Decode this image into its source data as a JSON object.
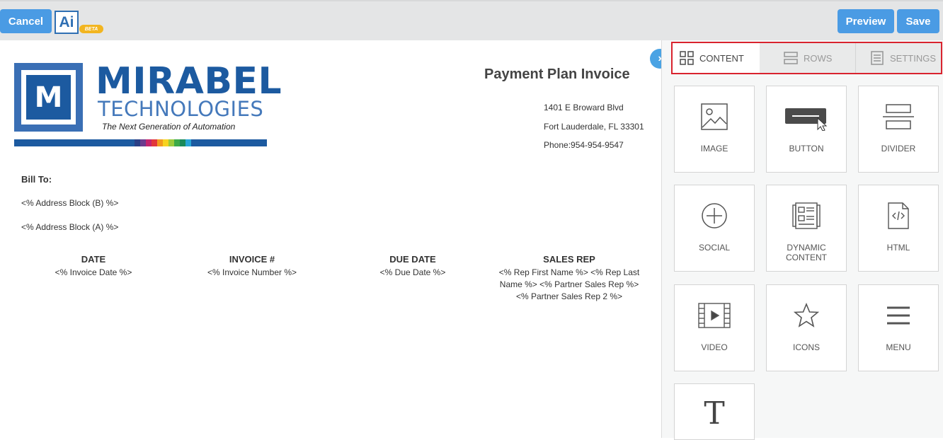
{
  "toolbar": {
    "cancel_label": "Cancel",
    "ai_label": "Ai",
    "beta_label": "BETA",
    "preview_label": "Preview",
    "save_label": "Save"
  },
  "colors": {
    "accent": "#4a9be4",
    "brand": "#1c5aa0",
    "highlight": "#d9232e"
  },
  "logo": {
    "letter": "M",
    "title": "MIRABEL",
    "subtitle": "TECHNOLOGIES",
    "tagline": "The Next Generation of Automation"
  },
  "invoice": {
    "title": "Payment Plan Invoice",
    "address_line1": "1401 E Broward Blvd",
    "address_line2": "Fort Lauderdale, FL 33301",
    "phone": "Phone:954-954-9547",
    "bill_to": "Bill To:",
    "address_block_b": "<% Address Block (B) %>",
    "address_block_a": "<% Address Block (A) %>",
    "columns": [
      {
        "header": "DATE",
        "value": "<% Invoice Date %>"
      },
      {
        "header": "INVOICE #",
        "value": "<% Invoice Number %>"
      },
      {
        "header": "DUE DATE",
        "value": "<% Due Date %>"
      },
      {
        "header": "SALES REP",
        "value": "<% Rep First Name %>  <% Rep Last Name %> <% Partner Sales Rep %> <% Partner Sales Rep 2 %>"
      }
    ]
  },
  "panel": {
    "tabs": [
      {
        "label": "CONTENT",
        "icon": "grid-icon",
        "active": true
      },
      {
        "label": "ROWS",
        "icon": "rows-icon",
        "active": false
      },
      {
        "label": "SETTINGS",
        "icon": "settings-icon",
        "active": false
      }
    ],
    "blocks": [
      {
        "label": "IMAGE",
        "icon": "image-icon"
      },
      {
        "label": "BUTTON",
        "icon": "button-icon"
      },
      {
        "label": "DIVIDER",
        "icon": "divider-icon"
      },
      {
        "label": "SOCIAL",
        "icon": "plus-circle-icon"
      },
      {
        "label": "DYNAMIC CONTENT",
        "icon": "dynamic-content-icon"
      },
      {
        "label": "HTML",
        "icon": "html-file-icon"
      },
      {
        "label": "VIDEO",
        "icon": "video-icon"
      },
      {
        "label": "ICONS",
        "icon": "star-icon"
      },
      {
        "label": "MENU",
        "icon": "menu-icon"
      },
      {
        "label": "",
        "icon": "text-icon"
      }
    ]
  }
}
